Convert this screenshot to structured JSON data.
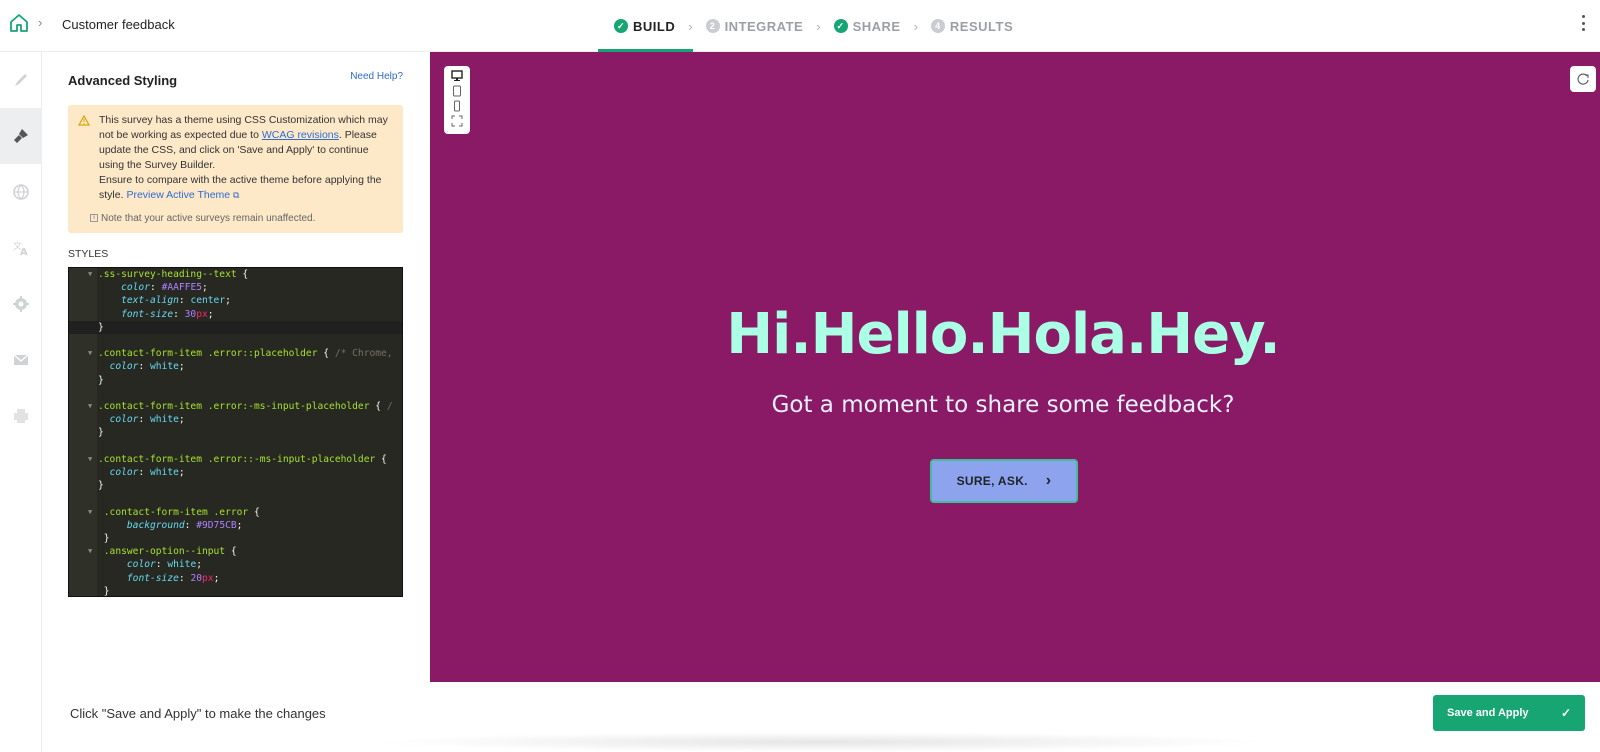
{
  "header": {
    "breadcrumb_title": "Customer feedback",
    "steps": [
      {
        "label": "BUILD",
        "state": "done"
      },
      {
        "label": "INTEGRATE",
        "number": "2"
      },
      {
        "label": "SHARE",
        "state": "done"
      },
      {
        "label": "RESULTS",
        "number": "4"
      }
    ]
  },
  "rail": {
    "items": [
      "brush-icon",
      "paint-icon",
      "globe-icon",
      "translate-icon",
      "gear-icon",
      "mail-icon",
      "print-icon"
    ],
    "active": "paint-icon"
  },
  "panel": {
    "title": "Advanced Styling",
    "help_link": "Need Help?",
    "warning": {
      "text_1": "This survey has a theme using CSS Customization which may not be working as expected due to ",
      "link_wcag": "WCAG revisions",
      "text_2": ". Please update the CSS, and click on 'Save and Apply' to continue using the Survey Builder.",
      "text_3": "Ensure to compare with the active theme before applying the style. ",
      "link_preview": "Preview Active Theme",
      "note": "Note that your active surveys remain unaffected."
    },
    "styles_label": "STYLES",
    "code_lines": [
      ".ss-survey-heading--text {",
      "    color: #AAFFE5;",
      "    text-align: center;",
      "    font-size: 30px;",
      "}",
      "",
      ".contact-form-item .error::placeholder { /* Chrome,",
      "  color: white;",
      "}",
      "",
      ".contact-form-item .error:-ms-input-placeholder { /",
      "  color: white;",
      "}",
      "",
      ".contact-form-item .error::-ms-input-placeholder {",
      "  color: white;",
      "}",
      "",
      " .contact-form-item .error {",
      "     background: #9D75CB;",
      " }",
      " .answer-option--input {",
      "     color: white;",
      "     font-size: 20px;",
      " }"
    ]
  },
  "preview": {
    "heading": "Hi.Hello.Hola.Hey.",
    "subheading": "Got a moment to share some feedback?",
    "cta_label": "SURE, ASK.",
    "background": "#8B1A66",
    "heading_color": "#AAFFE5",
    "button_color": "#8EA3EE"
  },
  "footer": {
    "hint": "Click \"Save and Apply\" to make the changes",
    "save_label": "Save and Apply"
  },
  "colors": {
    "accent": "#17A673",
    "warning_bg": "#FDE8C8",
    "link": "#2E6BD3"
  }
}
